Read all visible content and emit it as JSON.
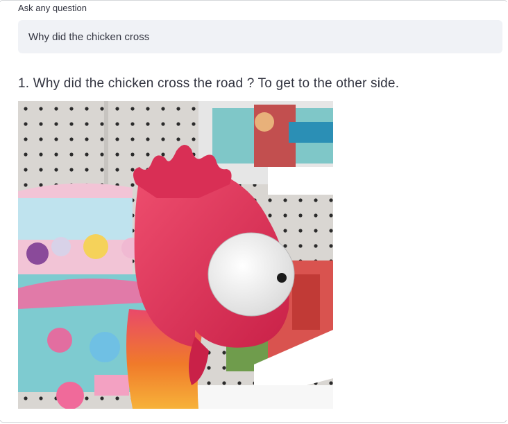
{
  "form": {
    "label": "Ask any question",
    "input_value": "Why did the chicken cross"
  },
  "results": [
    {
      "text": "1. Why did the chicken cross the road ? To get to the other side.",
      "image_icon": "rooster-toy-gif"
    }
  ],
  "colors": {
    "text": "#31333f",
    "input_bg": "#f0f2f6",
    "rooster": "#e2385a",
    "comb": "#d92f55",
    "beak": "#f08a1e"
  }
}
